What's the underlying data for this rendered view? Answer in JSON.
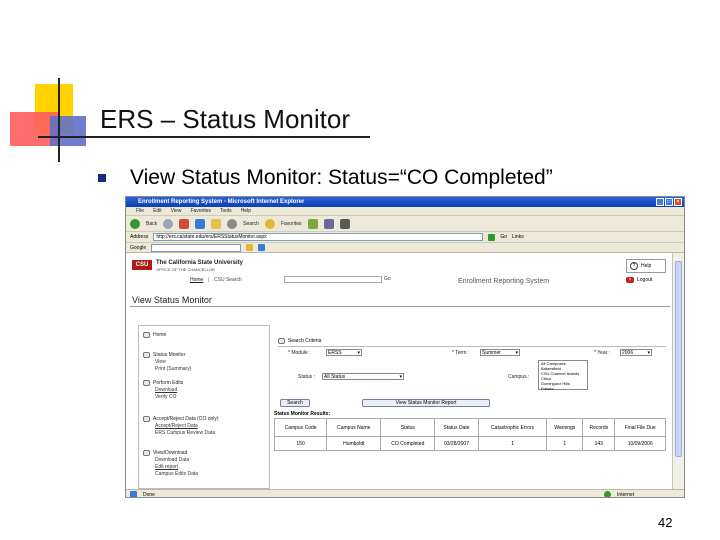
{
  "slide": {
    "title": "ERS – Status Monitor",
    "bullet": "View Status Monitor: Status=“CO Completed”",
    "page_number": "42"
  },
  "browser": {
    "window_title": "Enrollment Reporting System - Microsoft Internet Explorer",
    "menu": [
      "File",
      "Edit",
      "View",
      "Favorites",
      "Tools",
      "Help"
    ],
    "toolbar": {
      "back": "Back",
      "search": "Search",
      "favorites": "Favorites"
    },
    "address_label": "Address",
    "address": "http://ers.calstate.edu/ers/ERSStatusMonitor.aspx",
    "go_label": "Go",
    "links_label": "Links",
    "google_label": "Google",
    "statusbar": {
      "left": "Done",
      "right": "Internet"
    }
  },
  "page": {
    "logo": "CSU",
    "university": "The California State University",
    "university_sub": "OFFICE OF THE CHANCELLOR",
    "nav": {
      "home": "Home",
      "separator": "|",
      "search": "CSU Search"
    },
    "go_button": "Go",
    "system_name": "Enrollment Reporting System",
    "help": "Help",
    "logout": "Logout",
    "heading": "View Status Monitor"
  },
  "sidebar": [
    {
      "head": "Home",
      "subs": []
    },
    {
      "head": "Status Monitor",
      "subs": [
        "View",
        "Print (Summary)"
      ]
    },
    {
      "head": "Perform Edits",
      "subs": [
        "Download",
        "Verify CO"
      ]
    },
    {
      "head": "Accept/Reject Data (CO only)",
      "subs": [
        "Accept/Reject Data",
        "ERS Campus Review Data"
      ]
    },
    {
      "head": "View/Download",
      "subs": [
        "Download Data",
        "Edit report",
        "Campus Edits Data"
      ]
    }
  ],
  "criteria": {
    "heading": "Search Criteria",
    "module_label": "* Module :",
    "module_value": "ERSS",
    "term_label": "* Term :",
    "term_value": "Summer",
    "year_label": "* Year :",
    "year_value": "2006",
    "status_label": "Status :",
    "status_value": "All Status",
    "campus_label": "Campus :",
    "campus_options": [
      "All Campuses",
      "Bakersfield",
      "CSU Channel Islands",
      "Chico",
      "Dominguez Hills",
      "Fresno"
    ],
    "search_button": "Search",
    "export_button": "View Status Monitor Report"
  },
  "results": {
    "heading": "Status Monitor Results:",
    "columns": [
      "Campus Code",
      "Campus Name",
      "Status",
      "Status Date",
      "Catastrophic Errors",
      "Warnings",
      "Records",
      "Final File Due"
    ],
    "rows": [
      [
        "150",
        "Humboldt",
        "CO Completed",
        "03/28/2007",
        "1",
        "1",
        "143",
        "10/09/2006"
      ]
    ]
  }
}
